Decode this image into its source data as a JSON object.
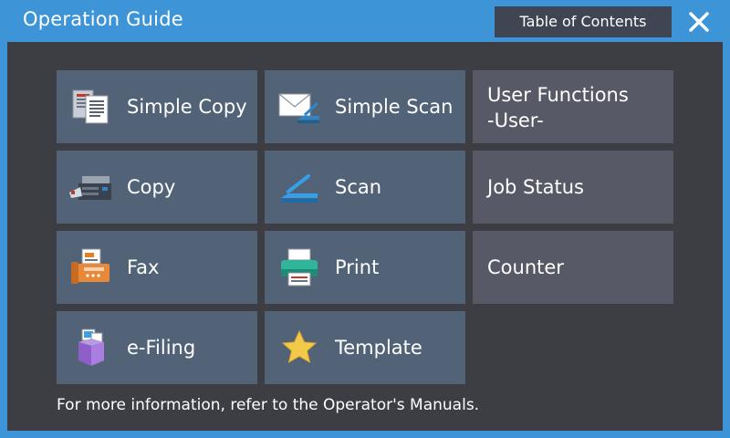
{
  "header": {
    "title": "Operation Guide",
    "toc_label": "Table of Contents",
    "close_icon": "close-icon"
  },
  "tiles": {
    "simple_copy": {
      "label": "Simple Copy",
      "icon": "simple-copy-icon"
    },
    "simple_scan": {
      "label": "Simple Scan",
      "icon": "simple-scan-icon"
    },
    "user_functions": {
      "line1": "User Functions",
      "line2": "-User-"
    },
    "copy": {
      "label": "Copy",
      "icon": "copier-icon"
    },
    "scan": {
      "label": "Scan",
      "icon": "scanner-icon"
    },
    "job_status": {
      "label": "Job Status"
    },
    "fax": {
      "label": "Fax",
      "icon": "fax-icon"
    },
    "print": {
      "label": "Print",
      "icon": "printer-icon"
    },
    "counter": {
      "label": "Counter"
    },
    "efiling": {
      "label": "e-Filing",
      "icon": "e-filing-box-icon"
    },
    "template": {
      "label": "Template",
      "icon": "star-icon"
    }
  },
  "footer": {
    "text": "For more information, refer to the Operator's Manuals."
  },
  "colors": {
    "titlebar": "#3d95d7",
    "panel": "#3d3d44",
    "function_tile": "#526378",
    "system_tile": "#575a66",
    "toc_button": "#3f4552",
    "star": "#f3c94a"
  }
}
